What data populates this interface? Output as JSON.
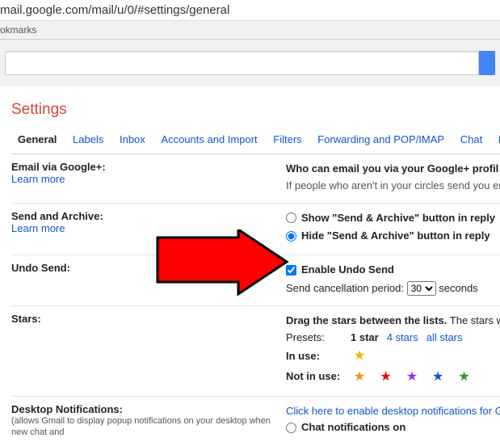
{
  "url": "mail.google.com/mail/u/0/#settings/general",
  "bookmarks_label": "okmarks",
  "title": "Settings",
  "tabs": [
    "General",
    "Labels",
    "Inbox",
    "Accounts and Import",
    "Filters",
    "Forwarding and POP/IMAP",
    "Chat",
    "L"
  ],
  "email_via": {
    "label": "Email via Google+:",
    "learn": "Learn more",
    "who": "Who can email you via your Google+ profil",
    "note": "If people who aren't in your circles send you em"
  },
  "send_archive": {
    "label": "Send and Archive:",
    "learn": "Learn more",
    "opt1": "Show \"Send & Archive\" button in reply",
    "opt2": "Hide \"Send & Archive\" button in reply"
  },
  "undo": {
    "label": "Undo Send:",
    "enable": "Enable Undo Send",
    "period_pre": "Send cancellation period:",
    "period_val": "30",
    "period_post": "seconds"
  },
  "stars": {
    "label": "Stars:",
    "drag": "Drag the stars between the lists.",
    "drag_post": "The stars w",
    "presets": "Presets:",
    "p1": "1 star",
    "p4": "4 stars",
    "pall": "all stars",
    "in_use": "In use:",
    "not_in_use": "Not in use:"
  },
  "desktop": {
    "label": "Desktop Notifications:",
    "sub": "(allows Gmail to display popup notifications on your desktop when new chat and",
    "click": "Click here to enable desktop notifications for G",
    "opt1": "Chat notifications on"
  }
}
